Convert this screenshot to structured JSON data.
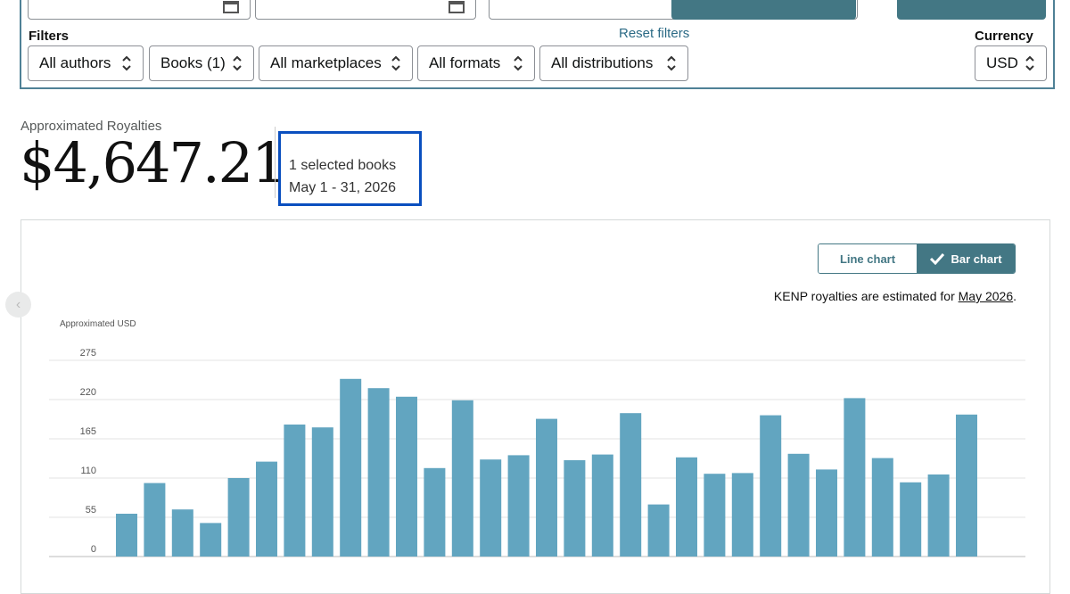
{
  "filters": {
    "label": "Filters",
    "reset_label": "Reset filters",
    "currency_label": "Currency",
    "author": "All authors",
    "books": "Books (1)",
    "marketplace": "All marketplaces",
    "format": "All formats",
    "distribution": "All distributions",
    "currency": "USD"
  },
  "royalties": {
    "label": "Approximated Royalties",
    "value": "$4,647.21",
    "selected_books": "1 selected books",
    "date_range": "May 1 - 31, 2026"
  },
  "chart_controls": {
    "line_label": "Line chart",
    "bar_label": "Bar chart",
    "kenp_note": "KENP royalties are estimated for ",
    "kenp_link": "May 2026",
    "kenp_suffix": "."
  },
  "icons": {
    "calendar": "calendar-icon",
    "chevron": "up-down-chevron-icon",
    "check": "check-icon",
    "prev": "chevron-left-icon"
  },
  "colors": {
    "accent": "#437784",
    "bar": "#62a5c0",
    "highlight_border": "#0a4fbf"
  },
  "chart_data": {
    "type": "bar",
    "ylabel": "Approximated USD",
    "y_ticks": [
      0,
      55,
      110,
      165,
      220,
      275
    ],
    "ylim": [
      0,
      275
    ],
    "grid": true,
    "values": [
      60,
      103,
      66,
      47,
      110,
      133,
      185,
      181,
      249,
      236,
      224,
      124,
      219,
      136,
      142,
      193,
      135,
      143,
      201,
      73,
      139,
      116,
      117,
      198,
      144,
      122,
      222,
      138,
      104,
      115,
      199
    ]
  }
}
